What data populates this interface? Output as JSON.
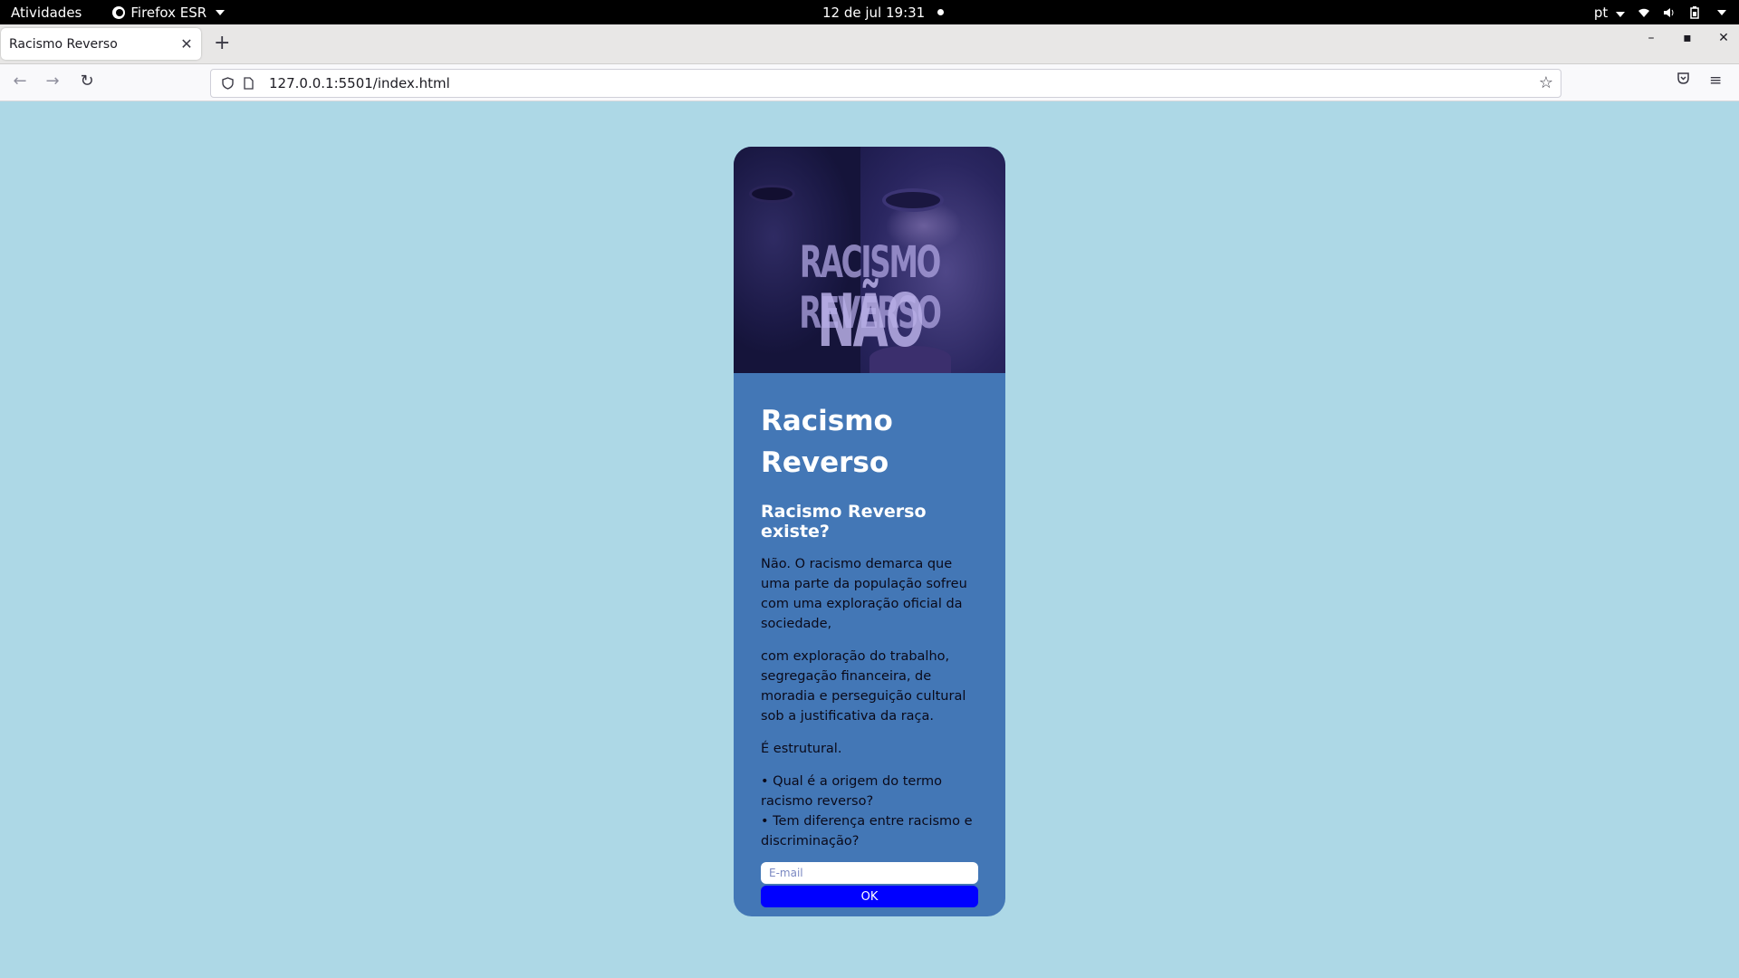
{
  "system_bar": {
    "activities": "Atividades",
    "app_menu": "Firefox ESR",
    "clock": "12 de jul  19:31",
    "language": "pt"
  },
  "browser": {
    "tab_title": "Racismo Reverso",
    "url": "127.0.0.1:5501/index.html"
  },
  "page": {
    "background_color": "#add8e6",
    "card_color": "#4377b6",
    "hero": {
      "line1": "RACISMO REVERSO",
      "line2": "NÃO EXISTE"
    },
    "title": "Racismo Reverso",
    "subtitle": "Racismo Reverso existe?",
    "paragraphs": [
      "Não. O racismo demarca que uma parte da população sofreu com uma exploração oficial da sociedade,",
      "com exploração do trabalho, segregação financeira, de moradia e perseguição cultural sob a justificativa da raça.",
      "É estrutural."
    ],
    "bullets": [
      "• Qual é a origem do termo racismo reverso?",
      "• Tem diferença entre racismo e discriminação?"
    ],
    "email_placeholder": "E-mail",
    "ok_label": "OK",
    "button_color": "#0000ff"
  }
}
